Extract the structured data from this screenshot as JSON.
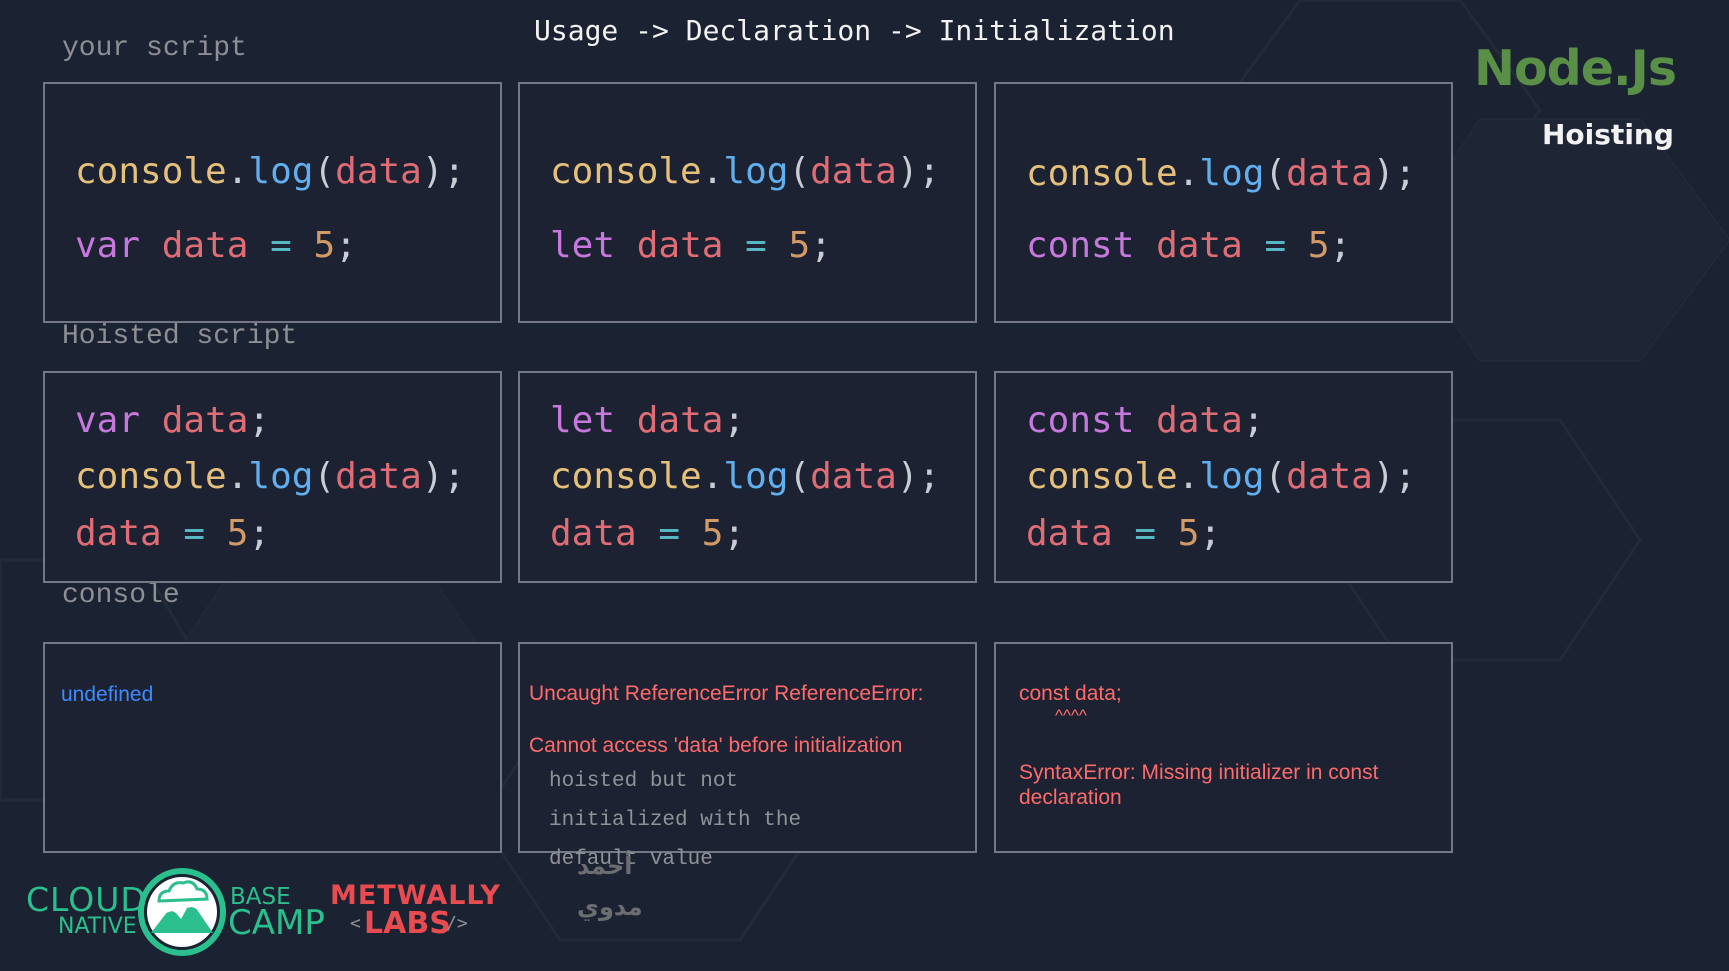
{
  "header": {
    "title": "Usage -> Declaration -> Initialization",
    "brand": "Node.Js",
    "subtitle": "Hoisting"
  },
  "sections": {
    "your_script": "your script",
    "hoisted_script": "Hoisted script",
    "console": "console"
  },
  "tokens": {
    "console": "console",
    "dot": ".",
    "log": "log",
    "lparen": "(",
    "rparen": ")",
    "semi": ";",
    "data": "data",
    "eq": "=",
    "five": "5",
    "var": "var",
    "let": "let",
    "const": "const"
  },
  "outputs": {
    "var": "undefined",
    "let_line1": "Uncaught ReferenceError ReferenceError:",
    "let_line2": "Cannot access 'data' before initialization",
    "let_note": "hoisted but not\ninitialized with the\ndefault value",
    "const_line1": "const data;",
    "const_line2": "^^^^",
    "const_line3": "SyntaxError: Missing initializer in const\ndeclaration"
  },
  "logos": {
    "cloud": "CLOUD",
    "native": "NATIVE",
    "base": "BASE",
    "camp": "CAMP",
    "metwally": "METWALLY",
    "labs": "LABS",
    "labs_lt": "<",
    "labs_gt": "/>",
    "arabic_1": "أحمد",
    "arabic_2": "مدوي"
  },
  "colors": {
    "background": "#1b2231",
    "box_border": "#737884",
    "keyword": "#c678dd",
    "object": "#e5c07b",
    "function": "#61afef",
    "variable": "#e06c75",
    "operator": "#56b6c2",
    "number": "#d19a66",
    "output_blue": "#3d8bff",
    "output_red": "#ff6b6b",
    "brand_green": "#5a8f47",
    "logo_teal": "#2bbf8e",
    "logo_red": "#e84b50"
  }
}
